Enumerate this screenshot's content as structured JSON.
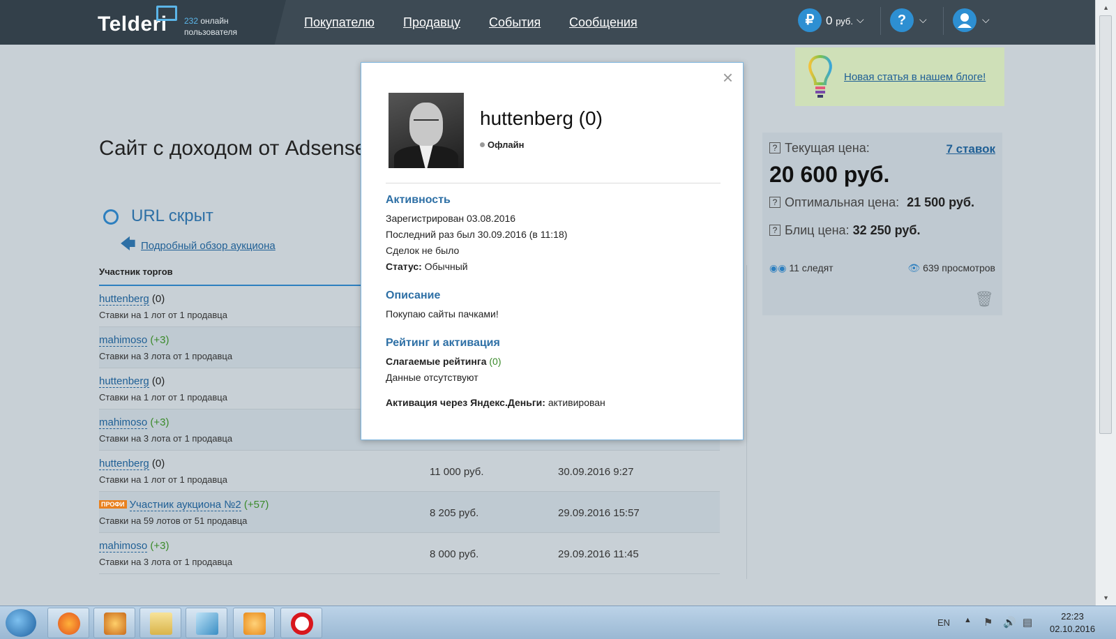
{
  "header": {
    "logo": "Telderi",
    "online_count": "232",
    "online_label_1": "онлайн",
    "online_label_2": "пользователя",
    "nav": [
      "Покупателю",
      "Продавцу",
      "События",
      "Сообщения"
    ],
    "balance_symbol": "₽",
    "balance": "0",
    "balance_unit": "руб.",
    "help_symbol": "?"
  },
  "page": {
    "title": "Сайт с доходом от Adsense",
    "url_hidden": "URL скрыт",
    "overview_link": "Подробный обзор аукциона",
    "participants_head": "Участник торгов"
  },
  "bids": [
    {
      "name": "huttenberg",
      "rating": "(0)",
      "positive": false,
      "sub": "Ставки на 1 лот от 1 продавца",
      "amount": "",
      "date": "",
      "pro": false
    },
    {
      "name": "mahimoso",
      "rating": "(+3)",
      "positive": true,
      "sub": "Ставки на 3 лота от 1 продавца",
      "amount": "",
      "date": "",
      "pro": false
    },
    {
      "name": "huttenberg",
      "rating": "(0)",
      "positive": false,
      "sub": "Ставки на 1 лот от 1 продавца",
      "amount": "",
      "date": "",
      "pro": false
    },
    {
      "name": "mahimoso",
      "rating": "(+3)",
      "positive": true,
      "sub": "Ставки на 3 лота от 1 продавца",
      "amount": "",
      "date": "",
      "pro": false
    },
    {
      "name": "huttenberg",
      "rating": "(0)",
      "positive": false,
      "sub": "Ставки на 1 лот от 1 продавца",
      "amount": "11 000 руб.",
      "date": "30.09.2016 9:27",
      "pro": false
    },
    {
      "name": "Участник аукциона №2",
      "rating": "(+57)",
      "positive": true,
      "sub": "Ставки на 59 лотов от 51 продавца",
      "amount": "8 205 руб.",
      "date": "29.09.2016 15:57",
      "pro": true,
      "pro_label": "ПРОФИ"
    },
    {
      "name": "mahimoso",
      "rating": "(+3)",
      "positive": true,
      "sub": "Ставки на 3 лота от 1 продавца",
      "amount": "8 000 руб.",
      "date": "29.09.2016 11:45",
      "pro": false
    }
  ],
  "sidebar": {
    "blog_link": "Новая статья в нашем блоге!",
    "current_price_label": "Текущая цена:",
    "bids_link": "7 ставок",
    "current_price": "20 600 руб.",
    "optimal_label": "Оптимальная цена:",
    "optimal_price": "21 500 руб.",
    "blitz_label": "Блиц цена:",
    "blitz_price": "32 250 руб.",
    "watchers": "11 следят",
    "views": "639 просмотров",
    "qmark": "?"
  },
  "modal": {
    "close": "×",
    "username": "huttenberg (0)",
    "status": "Офлайн",
    "activity_head": "Активность",
    "registered": "Зарегистрирован 03.08.2016",
    "last_seen": "Последний раз был 30.09.2016 (в 11:18)",
    "deals": "Сделок не было",
    "status_label": "Статус:",
    "status_value": "Обычный",
    "description_head": "Описание",
    "description": "Покупаю сайты пачками!",
    "rating_head": "Рейтинг и активация",
    "rating_terms_label": "Слагаемые рейтинга",
    "rating_terms_value": "(0)",
    "no_data": "Данные отсутствуют",
    "yandex_label": "Активация через Яндекс.Деньги:",
    "yandex_value": "активирован"
  },
  "taskbar": {
    "lang": "EN",
    "time": "22:23",
    "date": "02.10.2016"
  }
}
